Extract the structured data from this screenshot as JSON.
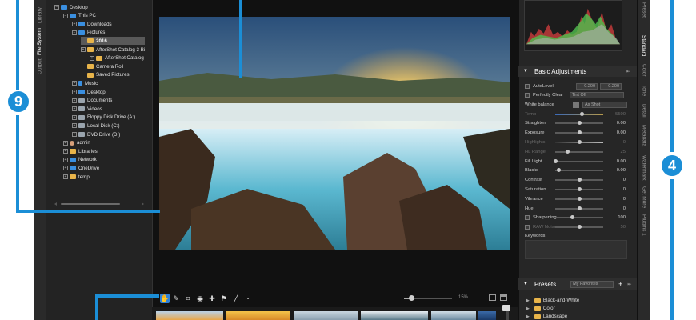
{
  "left_tabs": [
    {
      "label": "Library",
      "active": false
    },
    {
      "label": "File System",
      "active": true
    },
    {
      "label": "Output",
      "active": false
    }
  ],
  "tree": [
    {
      "label": "Desktop",
      "icon": "blue",
      "exp": "-",
      "indent": 0
    },
    {
      "label": "This PC",
      "icon": "blue",
      "exp": "-",
      "indent": 1
    },
    {
      "label": "Downloads",
      "icon": "blue",
      "exp": "+",
      "indent": 2
    },
    {
      "label": "Pictures",
      "icon": "blue",
      "exp": "-",
      "indent": 2
    },
    {
      "label": "2016",
      "icon": "folder",
      "exp": "",
      "indent": 3,
      "selected": true
    },
    {
      "label": "AfterShot Catalog 3 Bi",
      "icon": "folder",
      "exp": "+",
      "indent": 3
    },
    {
      "label": "AfterShot Catalog",
      "icon": "folder",
      "exp": "+",
      "indent": 4
    },
    {
      "label": "Camera Roll",
      "icon": "folder",
      "exp": "",
      "indent": 3
    },
    {
      "label": "Saved Pictures",
      "icon": "folder",
      "exp": "",
      "indent": 3
    },
    {
      "label": "Music",
      "icon": "music",
      "exp": "+",
      "indent": 2
    },
    {
      "label": "Desktop",
      "icon": "blue",
      "exp": "+",
      "indent": 2
    },
    {
      "label": "Documents",
      "icon": "drive",
      "exp": "+",
      "indent": 2
    },
    {
      "label": "Videos",
      "icon": "drive",
      "exp": "+",
      "indent": 2
    },
    {
      "label": "Floppy Disk Drive (A:)",
      "icon": "drive",
      "exp": "+",
      "indent": 2
    },
    {
      "label": "Local Disk (C:)",
      "icon": "drive",
      "exp": "+",
      "indent": 2
    },
    {
      "label": "DVD Drive (D:)",
      "icon": "drive",
      "exp": "+",
      "indent": 2
    },
    {
      "label": "admin",
      "icon": "person",
      "exp": "+",
      "indent": 1
    },
    {
      "label": "Libraries",
      "icon": "folder",
      "exp": "+",
      "indent": 1
    },
    {
      "label": "Network",
      "icon": "blue",
      "exp": "+",
      "indent": 1
    },
    {
      "label": "OneDrive",
      "icon": "blue",
      "exp": "+",
      "indent": 1
    },
    {
      "label": "temp",
      "icon": "folder",
      "exp": "+",
      "indent": 1
    }
  ],
  "toolbar": {
    "tools": [
      "hand-icon",
      "eyedropper-icon",
      "crop-icon",
      "red-eye-icon",
      "heal-icon",
      "region-icon",
      "brush-icon",
      "chevron-down-icon"
    ],
    "zoom_value": 0.15,
    "zoom_label": "15%"
  },
  "basic_adjustments": {
    "title": "Basic Adjustments",
    "autolevel_label": "AutoLevel",
    "autolevel_low": "0.200",
    "autolevel_high": "0.200",
    "perfectly_clear_label": "Perfectly Clear",
    "perfectly_clear_value": "Tint Off",
    "white_balance_label": "White balance",
    "white_balance_value": "As Shot",
    "sliders": [
      {
        "label": "Temp",
        "value": "5500",
        "pos": 0.55,
        "dim": true
      },
      {
        "label": "Straighten",
        "value": "0.00",
        "pos": 0.5,
        "dim": false
      },
      {
        "label": "Exposure",
        "value": "0.00",
        "pos": 0.5,
        "dim": false
      },
      {
        "label": "Highlights",
        "value": "0",
        "pos": 0.5,
        "dim": true
      },
      {
        "label": "HL Range",
        "value": "25",
        "pos": 0.25,
        "dim": true
      },
      {
        "label": "Fill Light",
        "value": "0.00",
        "pos": 0.0,
        "dim": false
      },
      {
        "label": "Blacks",
        "value": "0.00",
        "pos": 0.08,
        "dim": false
      },
      {
        "label": "Contrast",
        "value": "0",
        "pos": 0.5,
        "dim": false
      },
      {
        "label": "Saturation",
        "value": "0",
        "pos": 0.5,
        "dim": false
      },
      {
        "label": "Vibrance",
        "value": "0",
        "pos": 0.5,
        "dim": false
      },
      {
        "label": "Hue",
        "value": "0",
        "pos": 0.5,
        "dim": false
      },
      {
        "label": "Sharpening",
        "value": "100",
        "pos": 0.35,
        "dim": false,
        "checkbox": true
      },
      {
        "label": "RAW Noise",
        "value": "50",
        "pos": 0.5,
        "dim": true,
        "checkbox": true
      }
    ],
    "keywords_label": "Keywords"
  },
  "presets": {
    "title": "Presets",
    "dropdown_value": "My Favorites",
    "items": [
      "Black-and-White",
      "Color",
      "Landscape"
    ]
  },
  "right_tabs": [
    {
      "label": "Preset",
      "active": false
    },
    {
      "label": "Standard",
      "active": true
    },
    {
      "label": "Color",
      "active": false
    },
    {
      "label": "Tone",
      "active": false
    },
    {
      "label": "Detail",
      "active": false
    },
    {
      "label": "Metadata",
      "active": false
    },
    {
      "label": "Watermark",
      "active": false
    },
    {
      "label": "Get More",
      "active": false
    },
    {
      "label": "Plugins 1",
      "active": false
    }
  ],
  "callouts": {
    "left_number": "9",
    "right_number": "4"
  },
  "colors": {
    "accent": "#1b8ed6",
    "tool_active": "#2f82d8"
  }
}
